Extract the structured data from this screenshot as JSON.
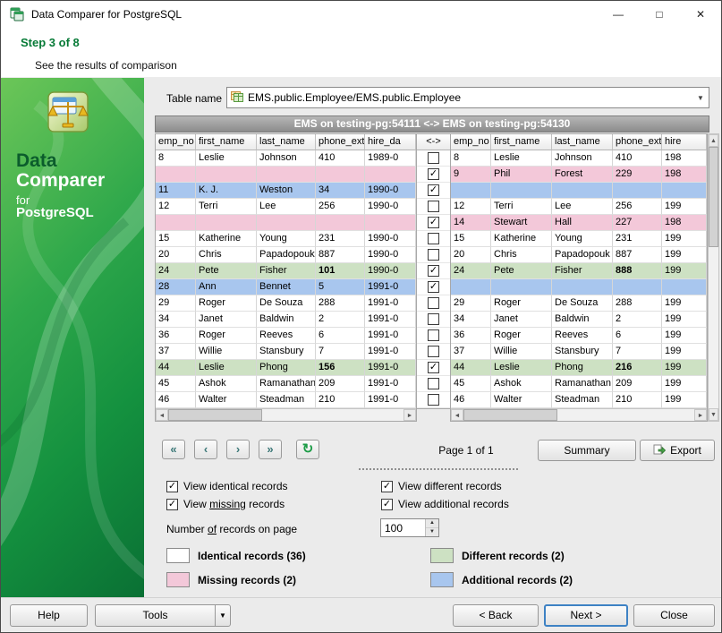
{
  "window": {
    "title": "Data Comparer for PostgreSQL"
  },
  "icons": {
    "minimize": "—",
    "maximize": "□",
    "close": "✕",
    "dropdown": "▼",
    "first": "«",
    "prev": "‹",
    "next": "›",
    "last": "»",
    "refresh": "↻",
    "scroll_left": "◄",
    "scroll_right": "►",
    "scroll_up": "▲",
    "scroll_down": "▼",
    "spin_up": "▲",
    "spin_down": "▼",
    "check": "✓"
  },
  "wizard": {
    "step_title": "Step 3 of 8",
    "step_subtitle": "See the results of comparison"
  },
  "branding": {
    "line1": "Data",
    "line2": "Comparer",
    "line3": "for",
    "line4": "PostgreSQL"
  },
  "toolbar": {
    "table_name_label": "Table name",
    "table_name_value": "EMS.public.Employee/EMS.public.Employee"
  },
  "comparison": {
    "header": "EMS on testing-pg:54111 <-> EMS on testing-pg:54130",
    "middle_header": "<->",
    "left_columns": [
      "emp_no",
      "first_name",
      "last_name",
      "phone_ext",
      "hire_da"
    ],
    "right_columns": [
      "emp_no",
      "first_name",
      "last_name",
      "phone_ext",
      "hire"
    ],
    "rows": [
      {
        "type": "identical",
        "checked": false,
        "left": [
          "8",
          "Leslie",
          "Johnson",
          "410",
          "1989-0"
        ],
        "right": [
          "8",
          "Leslie",
          "Johnson",
          "410",
          "198"
        ]
      },
      {
        "type": "missing",
        "checked": true,
        "left": [
          "",
          "",
          "",
          "",
          ""
        ],
        "right": [
          "9",
          "Phil",
          "Forest",
          "229",
          "198"
        ]
      },
      {
        "type": "additional",
        "checked": true,
        "left": [
          "11",
          "K. J.",
          "Weston",
          "34",
          "1990-0"
        ],
        "right": [
          "",
          "",
          "",
          "",
          ""
        ]
      },
      {
        "type": "identical",
        "checked": false,
        "left": [
          "12",
          "Terri",
          "Lee",
          "256",
          "1990-0"
        ],
        "right": [
          "12",
          "Terri",
          "Lee",
          "256",
          "199"
        ]
      },
      {
        "type": "missing",
        "checked": true,
        "left": [
          "",
          "",
          "",
          "",
          ""
        ],
        "right": [
          "14",
          "Stewart",
          "Hall",
          "227",
          "198"
        ]
      },
      {
        "type": "identical",
        "checked": false,
        "left": [
          "15",
          "Katherine",
          "Young",
          "231",
          "1990-0"
        ],
        "right": [
          "15",
          "Katherine",
          "Young",
          "231",
          "199"
        ]
      },
      {
        "type": "identical",
        "checked": false,
        "left": [
          "20",
          "Chris",
          "Papadopouk",
          "887",
          "1990-0"
        ],
        "right": [
          "20",
          "Chris",
          "Papadopouk",
          "887",
          "199"
        ]
      },
      {
        "type": "different",
        "checked": true,
        "bold_col": 3,
        "left": [
          "24",
          "Pete",
          "Fisher",
          "101",
          "1990-0"
        ],
        "right": [
          "24",
          "Pete",
          "Fisher",
          "888",
          "199"
        ]
      },
      {
        "type": "additional",
        "checked": true,
        "left": [
          "28",
          "Ann",
          "Bennet",
          "5",
          "1991-0"
        ],
        "right": [
          "",
          "",
          "",
          "",
          ""
        ]
      },
      {
        "type": "identical",
        "checked": false,
        "left": [
          "29",
          "Roger",
          "De Souza",
          "288",
          "1991-0"
        ],
        "right": [
          "29",
          "Roger",
          "De Souza",
          "288",
          "199"
        ]
      },
      {
        "type": "identical",
        "checked": false,
        "left": [
          "34",
          "Janet",
          "Baldwin",
          "2",
          "1991-0"
        ],
        "right": [
          "34",
          "Janet",
          "Baldwin",
          "2",
          "199"
        ]
      },
      {
        "type": "identical",
        "checked": false,
        "left": [
          "36",
          "Roger",
          "Reeves",
          "6",
          "1991-0"
        ],
        "right": [
          "36",
          "Roger",
          "Reeves",
          "6",
          "199"
        ]
      },
      {
        "type": "identical",
        "checked": false,
        "left": [
          "37",
          "Willie",
          "Stansbury",
          "7",
          "1991-0"
        ],
        "right": [
          "37",
          "Willie",
          "Stansbury",
          "7",
          "199"
        ]
      },
      {
        "type": "different",
        "checked": true,
        "bold_col": 3,
        "left": [
          "44",
          "Leslie",
          "Phong",
          "156",
          "1991-0"
        ],
        "right": [
          "44",
          "Leslie",
          "Phong",
          "216",
          "199"
        ]
      },
      {
        "type": "identical",
        "checked": false,
        "left": [
          "45",
          "Ashok",
          "Ramanathan",
          "209",
          "1991-0"
        ],
        "right": [
          "45",
          "Ashok",
          "Ramanathan",
          "209",
          "199"
        ]
      },
      {
        "type": "identical",
        "checked": false,
        "left": [
          "46",
          "Walter",
          "Steadman",
          "210",
          "1991-0"
        ],
        "right": [
          "46",
          "Walter",
          "Steadman",
          "210",
          "199"
        ]
      }
    ]
  },
  "pager": {
    "page_label": "Page 1 of 1",
    "summary_label": "Summary",
    "export_label": "Export"
  },
  "options": {
    "view_identical": {
      "label": "View identical records",
      "checked": true
    },
    "view_different": {
      "label": "View different records",
      "checked": true
    },
    "view_missing": {
      "label": "View missing records",
      "checked": true,
      "underline": "missing"
    },
    "view_additional": {
      "label": "View additional records",
      "checked": true
    },
    "records_per_page": {
      "label": "Number of records on page",
      "underline": "of",
      "value": "100"
    }
  },
  "legend": [
    {
      "label": "Identical records (36)",
      "type": "identical"
    },
    {
      "label": "Different records (2)",
      "type": "different"
    },
    {
      "label": "Missing records (2)",
      "type": "missing"
    },
    {
      "label": "Additional records (2)",
      "type": "additional"
    }
  ],
  "footer": {
    "help": "Help",
    "tools": "Tools",
    "back": "< Back",
    "next": "Next >",
    "close": "Close"
  },
  "colors": {
    "identical": "#ffffff",
    "different": "#cde1c3",
    "missing": "#f3c8d9",
    "additional": "#a8c6ee",
    "refresh_green": "#1d9c47",
    "focus_blue": "#3e82c4",
    "brand_green": "#14913f"
  }
}
